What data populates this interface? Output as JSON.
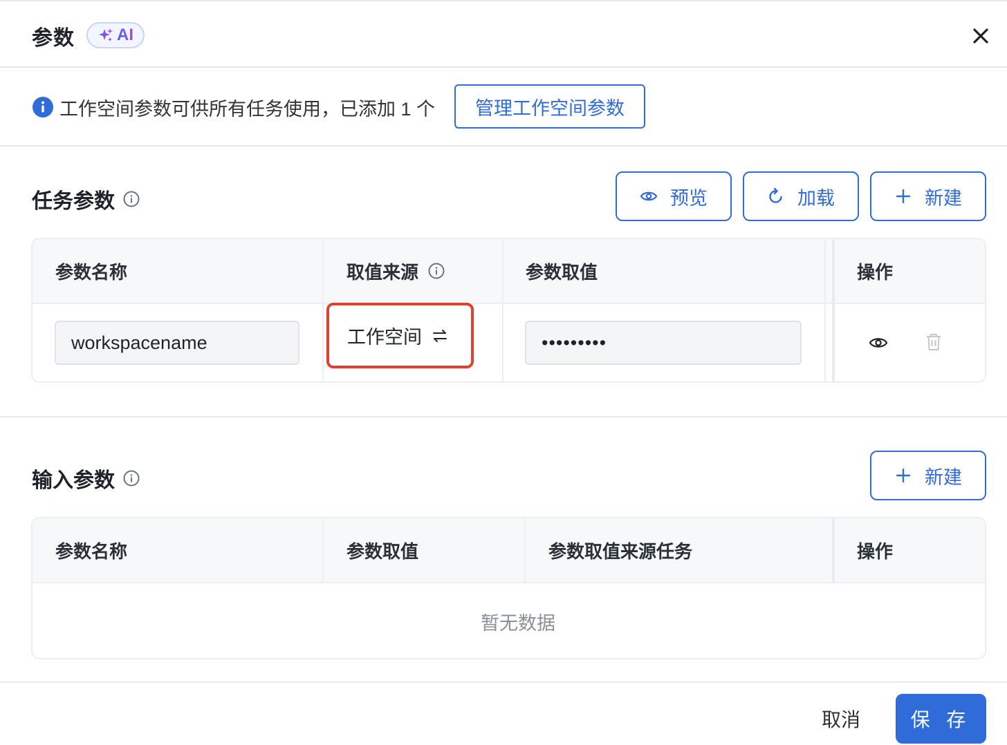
{
  "header": {
    "title": "参数",
    "ai_badge": "AI"
  },
  "notice": {
    "text": "工作空间参数可供所有任务使用，已添加 1 个",
    "manage_button": "管理工作空间参数"
  },
  "task_params": {
    "title": "任务参数",
    "buttons": {
      "preview": "预览",
      "load": "加载",
      "new": "新建"
    },
    "columns": [
      "参数名称",
      "取值来源",
      "参数取值",
      "操作"
    ],
    "rows": [
      {
        "name": "workspacename",
        "source": "工作空间",
        "value": "•••••••••"
      }
    ]
  },
  "input_params": {
    "title": "输入参数",
    "new_button": "新建",
    "columns": [
      "参数名称",
      "参数取值",
      "参数取值来源任务",
      "操作"
    ],
    "empty": "暂无数据"
  },
  "footer": {
    "cancel": "取消",
    "save": "保 存"
  },
  "colors": {
    "primary": "#2f6bd9",
    "highlight": "#e0402f"
  }
}
